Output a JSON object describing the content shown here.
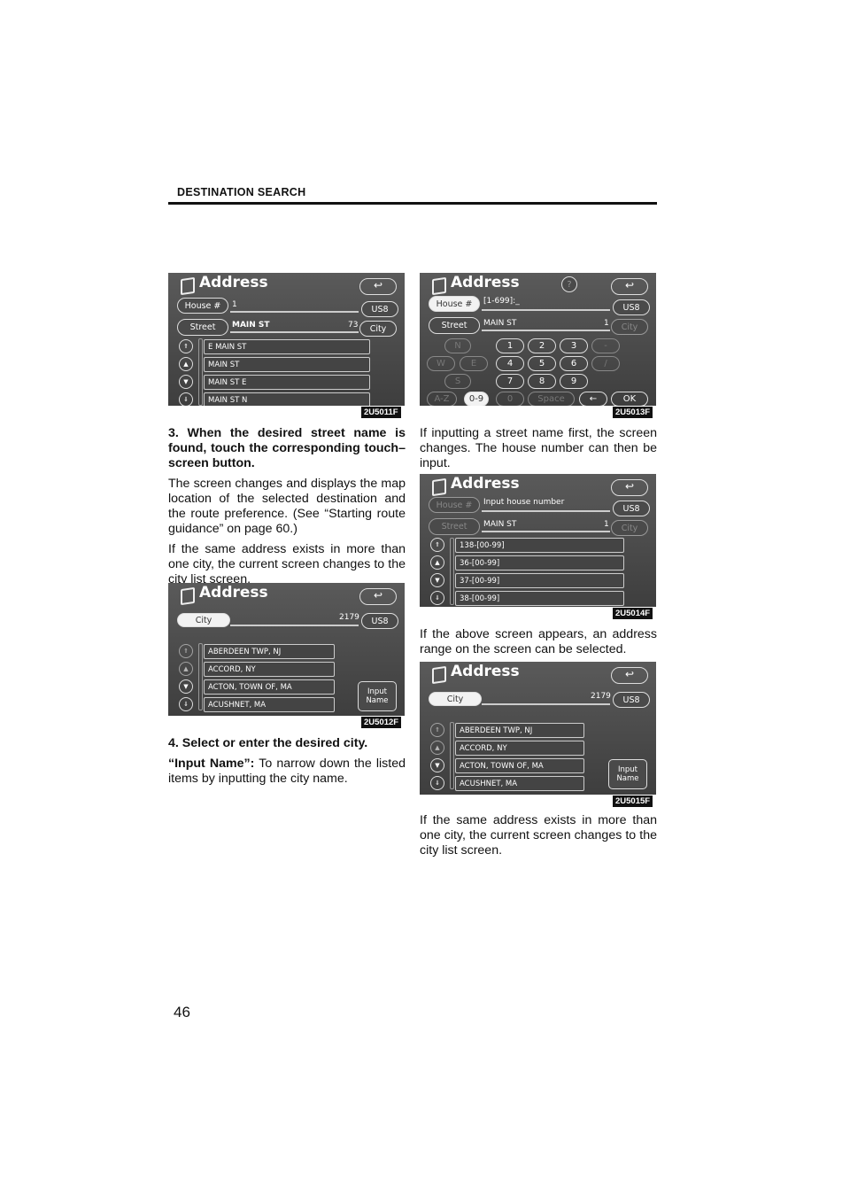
{
  "header": {
    "section": "DESTINATION SEARCH",
    "page_number": "46"
  },
  "screens": {
    "s1": {
      "code": "2U5011F",
      "title": "Address",
      "house_btn": "House #",
      "house_value": "1",
      "street_btn": "Street",
      "street_value": "MAIN ST",
      "count": "73",
      "us8": "US8",
      "city_btn": "City",
      "items": [
        "E MAIN ST",
        "MAIN ST",
        "MAIN ST E",
        "MAIN ST N"
      ]
    },
    "s2": {
      "code": "2U5013F",
      "title": "Address",
      "help": "?",
      "house_btn": "House #",
      "house_value": "[1-699]:_",
      "street_btn": "Street",
      "street_value": "MAIN ST",
      "count": "1",
      "us8": "US8",
      "city_btn": "City",
      "keys": {
        "n": "N",
        "w": "W",
        "e": "E",
        "s": "S",
        "k1": "1",
        "k2": "2",
        "k3": "3",
        "dash": "-",
        "k4": "4",
        "k5": "5",
        "k6": "6",
        "slash": "/",
        "k7": "7",
        "k8": "8",
        "k9": "9",
        "az": "A-Z",
        "k09": "0-9",
        "k0": "0",
        "space": "Space",
        "bksp": "←",
        "ok": "OK"
      }
    },
    "s3": {
      "code": "2U5012F",
      "title": "Address",
      "city_btn": "City",
      "count": "2179",
      "us8": "US8",
      "items": [
        "ABERDEEN TWP, NJ",
        "ACCORD, NY",
        "ACTON, TOWN OF, MA",
        "ACUSHNET, MA"
      ],
      "input_name": "Input Name"
    },
    "s4": {
      "code": "2U5014F",
      "title": "Address",
      "house_btn": "House #",
      "prompt": "Input house number",
      "street_btn": "Street",
      "street_value": "MAIN ST",
      "count": "1",
      "us8": "US8",
      "city_btn": "City",
      "items": [
        "138-[00-99]",
        "36-[00-99]",
        "37-[00-99]",
        "38-[00-99]"
      ]
    },
    "s5": {
      "code": "2U5015F",
      "title": "Address",
      "city_btn": "City",
      "count": "2179",
      "us8": "US8",
      "items": [
        "ABERDEEN TWP, NJ",
        "ACCORD, NY",
        "ACTON, TOWN OF, MA",
        "ACUSHNET, MA"
      ],
      "input_name": "Input Name"
    }
  },
  "left": {
    "step3": "3. When the desired street name is found, touch the corresponding touch–screen button.",
    "p1": "The screen changes and displays the map location of the selected destination and the route preference.  (See “Starting route guidance” on page 60.)",
    "p2": "If the same address exists in more than one city, the current screen changes to the city list screen.",
    "step4": "4.  Select or enter the desired city.",
    "input_name_term": "“Input Name”:",
    "input_name_desc": " To narrow down the listed items by inputting the city name."
  },
  "right": {
    "p1": "If inputting a street name first, the screen changes.  The house number can then be input.",
    "p2": "If the above screen appears, an address range on the screen can be selected.",
    "p3": "If the same address exists in more than one city, the current screen changes to the city list screen."
  }
}
